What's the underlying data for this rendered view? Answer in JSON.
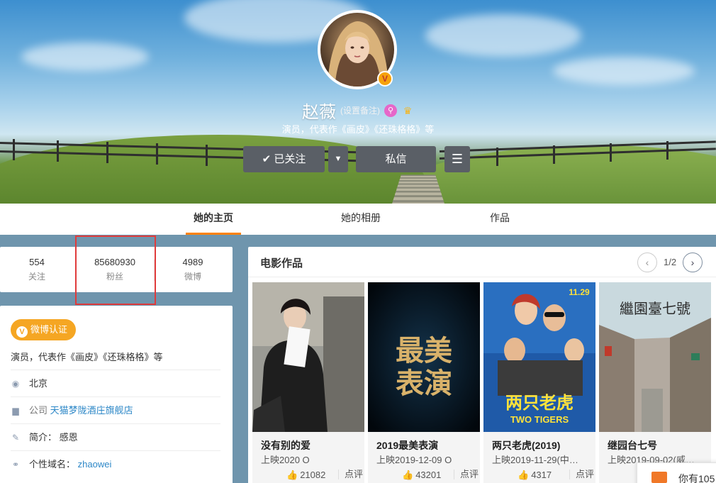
{
  "profile": {
    "name": "赵薇",
    "remark": "(设置备注)",
    "description": "演员，代表作《画皮》《还珠格格》等",
    "verified_badge": "V"
  },
  "actions": {
    "follow_label": "已关注",
    "follow_icon": "✔",
    "dropdown_icon": "▼",
    "message_label": "私信",
    "menu_icon": "☰"
  },
  "tabs": [
    {
      "label": "她的主页",
      "active": true
    },
    {
      "label": "她的相册",
      "active": false
    },
    {
      "label": "作品",
      "active": false
    }
  ],
  "stats": [
    {
      "value": "554",
      "label": "关注"
    },
    {
      "value": "85680930",
      "label": "粉丝"
    },
    {
      "value": "4989",
      "label": "微博"
    }
  ],
  "info": {
    "auth_label": "微博认证",
    "auth_icon": "V",
    "description": "演员，代表作《画皮》《还珠格格》等",
    "location_icon": "◉",
    "location": "北京",
    "company_icon": "▆",
    "company_label": "公司",
    "company_value": "天猫梦陇酒庄旗舰店",
    "bio_icon": "✎",
    "bio_label": "简介：",
    "bio_value": "感恩",
    "domain_icon": "⚭",
    "domain_label": "个性域名：",
    "domain_value": "zhaowei"
  },
  "films": {
    "title": "电影作品",
    "page": "1/2",
    "prev_icon": "‹",
    "next_icon": "›",
    "items": [
      {
        "title": "没有别的爱",
        "date": "上映2020 O",
        "likes": "21082",
        "comment_label": "点评"
      },
      {
        "title": "2019最美表演",
        "date": "上映2019-12-09 O",
        "likes": "43201",
        "comment_label": "点评"
      },
      {
        "title": "两只老虎(2019)",
        "date": "上映2019-11-29(中…",
        "likes": "4317",
        "comment_label": "点评"
      },
      {
        "title": "继园台七号",
        "date": "上映2019-09-02(威…",
        "likes": "",
        "comment_label": ""
      }
    ],
    "poster_text": {
      "p2_line1": "最美",
      "p2_line2": "表演",
      "p3_date": "11.29",
      "p3_title": "两只老虎",
      "p3_en": "TWO TIGERS",
      "p4_title": "繼園臺七號"
    }
  },
  "toast": {
    "text": "你有105"
  }
}
